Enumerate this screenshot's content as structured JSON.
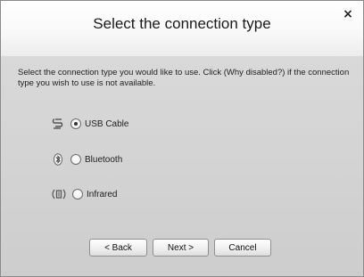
{
  "dialog": {
    "title": "Select the connection type",
    "close_label": "×",
    "instruction": "Select the connection type you would like to use. Click (Why disabled?) if the connection type you wish to use is not available."
  },
  "options": [
    {
      "label": "USB Cable",
      "icon": "usb-icon",
      "selected": true
    },
    {
      "label": "Bluetooth",
      "icon": "bluetooth-icon",
      "selected": false
    },
    {
      "label": "Infrared",
      "icon": "infrared-icon",
      "selected": false
    }
  ],
  "buttons": {
    "back": "< Back",
    "next": "Next >",
    "cancel": "Cancel"
  }
}
